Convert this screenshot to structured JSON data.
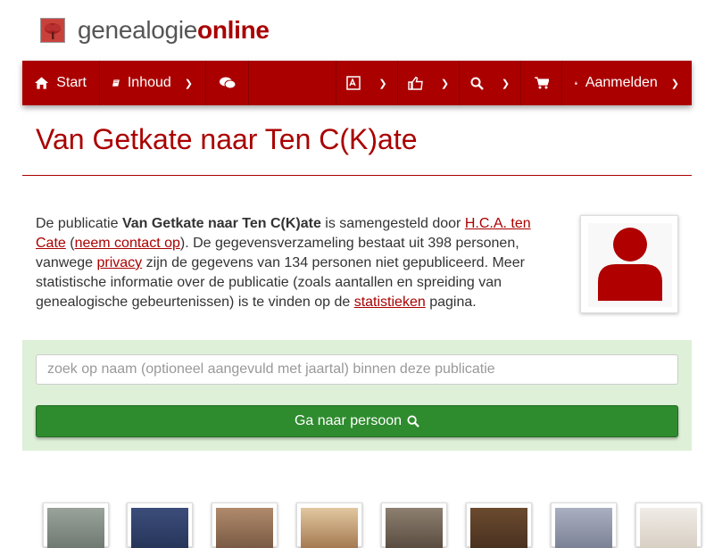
{
  "site": {
    "name_part1": "genealogie",
    "name_part2": "online"
  },
  "nav": {
    "start": "Start",
    "inhoud": "Inhoud",
    "login": "Aanmelden",
    "icons": [
      "home-icon",
      "book-icon",
      "comments-icon",
      "language-icon",
      "thumbs-up-icon",
      "search-icon",
      "cart-icon",
      "lock-icon"
    ]
  },
  "page": {
    "title": "Van Getkate naar Ten C(K)ate"
  },
  "intro": {
    "t1": "De publicatie ",
    "bold": "Van Getkate naar Ten C(K)ate",
    "t2": " is samengesteld door ",
    "author_link": "H.C.A. ten Cate",
    "t3": " (",
    "contact_link": "neem contact op",
    "t4": "). De gegevensverzameling bestaat uit 398 personen, vanwege ",
    "privacy_link": "privacy",
    "t5": " zijn de gegevens van 134 personen niet gepubliceerd. Meer statistische informatie over de publicatie (zoals aantallen en spreiding van genealogische gebeurtenissen) is te vinden op de ",
    "stats_link": "statistieken",
    "t6": " pagina."
  },
  "search": {
    "placeholder": "zoek op naam (optioneel aangevuld met jaartal) binnen deze publicatie",
    "button": "Ga naar persoon"
  },
  "colors": {
    "brand": "#aa0000",
    "panel": "#dff0d8",
    "button": "#2e8b2e"
  }
}
